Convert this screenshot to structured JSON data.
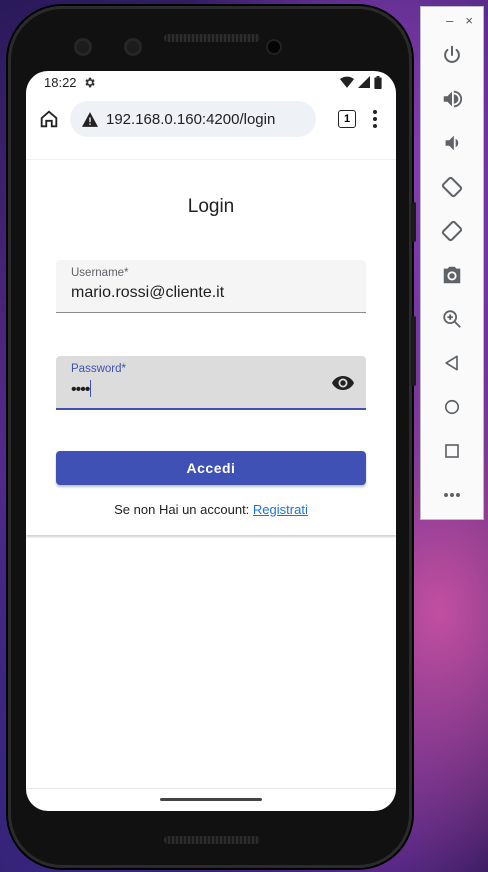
{
  "status_bar": {
    "time": "18:22"
  },
  "browser": {
    "url": "192.168.0.160:4200/login",
    "tab_count": "1"
  },
  "login": {
    "title": "Login",
    "username_label": "Username*",
    "username_value": "mario.rossi@cliente.it",
    "password_label": "Password*",
    "password_value": "••••",
    "submit_label": "Accedi",
    "register_prompt": "Se non Hai un account:",
    "register_link": "Registrati"
  },
  "emulator_panel": {
    "minimize_label": "–",
    "close_label": "×",
    "buttons": [
      "power-icon",
      "volume-up-icon",
      "volume-down-icon",
      "rotate-left-icon",
      "rotate-right-icon",
      "camera-icon",
      "zoom-icon",
      "back-icon",
      "home-icon",
      "overview-icon",
      "more-icon"
    ]
  },
  "colors": {
    "primary": "#3f51b5",
    "link": "#1a73e8"
  }
}
